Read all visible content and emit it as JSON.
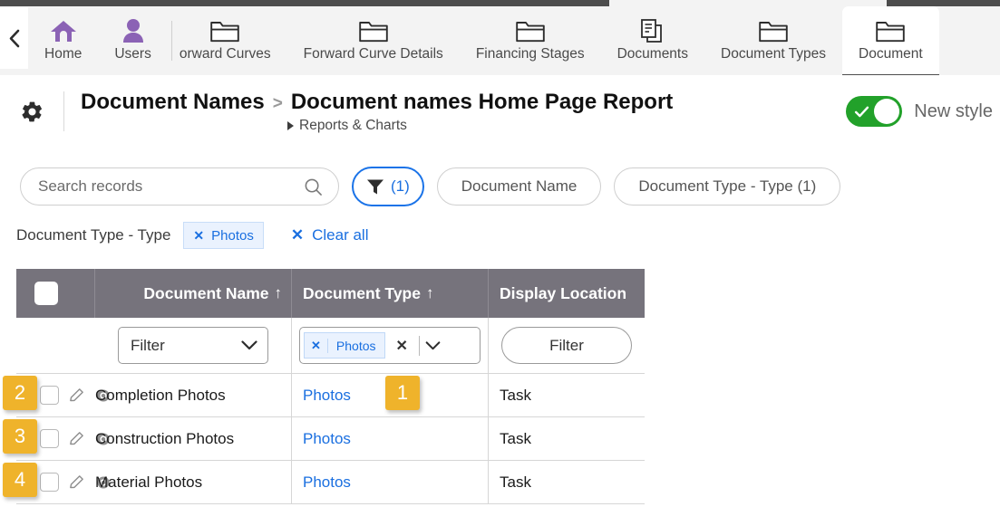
{
  "nav": {
    "back_icon": "chevron-left-icon",
    "items": [
      {
        "label": "Home",
        "icon": "home-icon",
        "icon_kind": "home",
        "active": false,
        "clipped": false
      },
      {
        "label": "Users",
        "icon": "users-icon",
        "icon_kind": "user",
        "active": false,
        "clipped": false
      },
      {
        "label": "orward Curves",
        "icon": "folder-icon",
        "icon_kind": "folder",
        "active": false,
        "clipped": true
      },
      {
        "label": "Forward Curve Details",
        "icon": "folder-icon",
        "icon_kind": "folder",
        "active": false,
        "clipped": false
      },
      {
        "label": "Financing Stages",
        "icon": "folder-icon",
        "icon_kind": "folder",
        "active": false,
        "clipped": false
      },
      {
        "label": "Documents",
        "icon": "documents-icon",
        "icon_kind": "docs",
        "active": false,
        "clipped": false
      },
      {
        "label": "Document Types",
        "icon": "folder-icon",
        "icon_kind": "folder",
        "active": false,
        "clipped": false
      },
      {
        "label": "Document",
        "icon": "folder-icon",
        "icon_kind": "folder",
        "active": true,
        "clipped": false
      }
    ]
  },
  "header": {
    "gear_icon": "gear-icon",
    "breadcrumb_root": "Document Names",
    "breadcrumb_separator": ">",
    "breadcrumb_current": "Document names Home Page Report",
    "sub_link": "Reports & Charts",
    "toggle_label": "New style",
    "toggle_on": true,
    "toggle_on_color": "#22a12a"
  },
  "filterbar": {
    "search_placeholder": "Search records",
    "search_value": "",
    "search_icon": "search-icon",
    "filter_icon": "funnel-icon",
    "filter_count": "(1)",
    "accent_blue": "#1a73e8",
    "pills": [
      {
        "label": "Document Name"
      },
      {
        "label": "Document Type - Type (1)"
      }
    ]
  },
  "applied": {
    "label": "Document Type - Type",
    "chips": [
      {
        "x": "✕",
        "label": "Photos"
      }
    ],
    "clear_all_x": "✕",
    "clear_all": "Clear all"
  },
  "table": {
    "header_bg": "#76737c",
    "columns": [
      {
        "key": "select",
        "label": "",
        "sort": ""
      },
      {
        "key": "name",
        "label": "Document Name",
        "sort": "↑"
      },
      {
        "key": "type",
        "label": "Document Type",
        "sort": "↑"
      },
      {
        "key": "display",
        "label": "Display Location",
        "sort": ""
      }
    ],
    "filter_row": {
      "name_select_label": "Filter",
      "name_select_icon": "chevron-down-icon",
      "type_chip_x": "✕",
      "type_chip_label": "Photos",
      "type_clear_icon": "✕",
      "type_dropdown_icon": "chevron-down-icon",
      "display_filter_label": "Filter"
    },
    "rows": [
      {
        "checked": false,
        "edit_icon": "pencil-icon",
        "view_icon": "eye-icon",
        "name": "Completion Photos",
        "type": "Photos",
        "display": "Task"
      },
      {
        "checked": false,
        "edit_icon": "pencil-icon",
        "view_icon": "eye-icon",
        "name": "Construction Photos",
        "type": "Photos",
        "display": "Task"
      },
      {
        "checked": false,
        "edit_icon": "pencil-icon",
        "view_icon": "eye-icon",
        "name": "Material Photos",
        "type": "Photos",
        "display": "Task"
      }
    ]
  },
  "annotations": {
    "badge_color": "#efb32b",
    "badges": [
      {
        "id": "b1",
        "number": "1"
      },
      {
        "id": "b2",
        "number": "2"
      },
      {
        "id": "b3",
        "number": "3"
      },
      {
        "id": "b4",
        "number": "4"
      }
    ]
  }
}
